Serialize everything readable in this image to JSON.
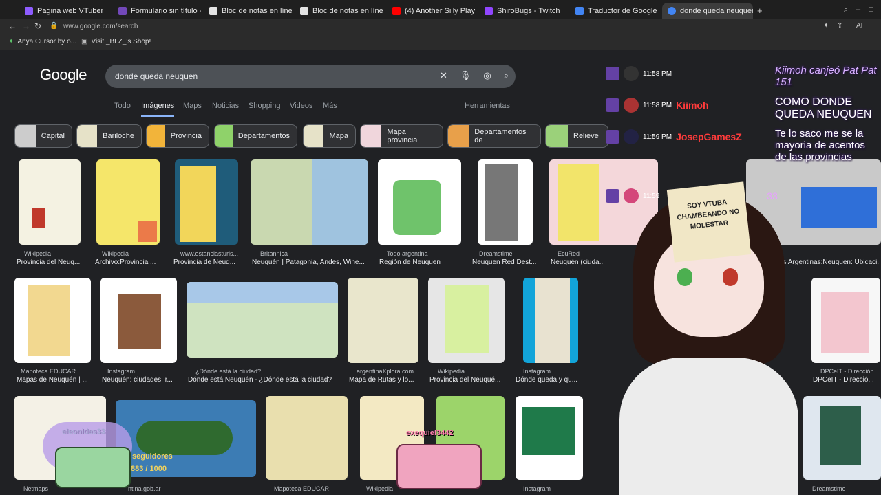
{
  "tabs": [
    {
      "label": "Pagina web VTuber",
      "color": "#8e5cff"
    },
    {
      "label": "Formulario sin título - Form",
      "color": "#7248b9"
    },
    {
      "label": "Bloc de notas en línea - Te",
      "color": "#e3e3e3"
    },
    {
      "label": "Bloc de notas en línea - Te",
      "color": "#e3e3e3"
    },
    {
      "label": "(4) Another Silly Playlis",
      "color": "#ff0000"
    },
    {
      "label": "ShiroBugs - Twitch",
      "color": "#9146ff"
    },
    {
      "label": "Traductor de Google",
      "color": "#4285f4"
    },
    {
      "label": "donde queda neuquen - Bu",
      "color": "#4285f4"
    }
  ],
  "address": {
    "url": "www.google.com/search"
  },
  "bookmarks": [
    {
      "label": "Anya Cursor by o..."
    },
    {
      "label": "Visit _BLZ_'s Shop!"
    }
  ],
  "google": {
    "logo": "Google",
    "query": "donde queda neuquen",
    "nav": [
      "Todo",
      "Imágenes",
      "Maps",
      "Noticias",
      "Shopping",
      "Videos",
      "Más"
    ],
    "tools": "Herramientas",
    "chips": [
      "Capital",
      "Bariloche",
      "Provincia",
      "Departamentos",
      "Mapa",
      "Mapa provincia",
      "Departamentos de",
      "Relieve"
    ]
  },
  "results_row1": [
    {
      "source": "Wikipedia",
      "title": "Provincia del Neuq..."
    },
    {
      "source": "Wikipedia",
      "title": "Archivo:Provincia ..."
    },
    {
      "source": "www.estanciasturis...",
      "title": "Provincia de Neuq..."
    },
    {
      "source": "Britannica",
      "title": "Neuquén | Patagonia, Andes, Wine..."
    },
    {
      "source": "Todo argentina",
      "title": "Región de Neuquen"
    },
    {
      "source": "Dreamstime",
      "title": "Neuquen Red Dest..."
    },
    {
      "source": "EcuRed",
      "title": "Neuquén (ciuda..."
    },
    {
      "source": "",
      "title": "as Argentinas:Neuquen: Ubicaci..."
    }
  ],
  "results_row2": [
    {
      "source": "Mapoteca EDUCAR",
      "title": "Mapas de Neuquén | ..."
    },
    {
      "source": "Instagram",
      "title": "Neuquén: ciudades, r..."
    },
    {
      "source": "¿Dónde está la ciudad?",
      "title": "Dónde está Neuquén - ¿Dónde está la ciudad?"
    },
    {
      "source": "argentinaXplora.com",
      "title": "Mapa de Rutas y lo..."
    },
    {
      "source": "Wikipedia",
      "title": "Provincia del Neuqué..."
    },
    {
      "source": "Instagram",
      "title": "Dónde queda y qu..."
    },
    {
      "source": "DPCeIT - Dirección ...",
      "title": "DPCeIT - Direcció..."
    }
  ],
  "results_row3": [
    {
      "source": "Netmaps"
    },
    {
      "source": "ntina.gob.ar"
    },
    {
      "source": "Mapoteca EDUCAR"
    },
    {
      "source": "Wikipedia"
    },
    {
      "source": "Instagram"
    },
    {
      "source": "Dreamstime"
    }
  ],
  "chat": [
    {
      "time": "11:58 PM",
      "user": "",
      "msg": ""
    },
    {
      "time": "11:58 PM",
      "user": "Kiimoh",
      "msg": ""
    },
    {
      "time": "11:59 PM",
      "user": "JosepGamesZ",
      "msg": ""
    },
    {
      "time": "11:59",
      "user": "",
      "msg": "33"
    }
  ],
  "overlay_text": {
    "redeem": "Kiimoh canjeó Pat Pat  151",
    "msg1": "COMO DONDE QUEDA NEUQUEN",
    "msg2": "Te lo saco me se la mayoria de acentos de las provincias",
    "sign": "SOY VTUBA CHAMBEANDO NO MOLESTAR",
    "follower1": "eleonidas33",
    "follower2": "exequiel3442",
    "followers_label": "seguidores",
    "followers_count": "883 / 1000"
  }
}
